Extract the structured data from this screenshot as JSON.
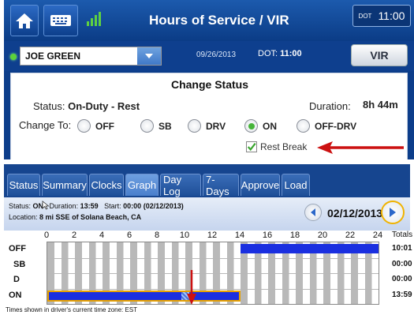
{
  "header": {
    "title": "Hours of Service / VIR",
    "dot_label": "DOT",
    "clock": "11:00",
    "driver_name": "JOE GREEN",
    "date": "09/26/2013",
    "dot_time_label": "DOT:",
    "dot_time": "11:00",
    "vir_label": "VIR"
  },
  "change_status": {
    "title": "Change Status",
    "status_label": "Status:",
    "status_value": "On-Duty - Rest",
    "duration_label": "Duration:",
    "duration_value": "8h 44m",
    "change_to_label": "Change To:",
    "options": [
      "OFF",
      "SB",
      "DRV",
      "ON",
      "OFF-DRV"
    ],
    "selected": "ON",
    "rest_break_label": "Rest Break",
    "rest_break_checked": true
  },
  "tabs": [
    {
      "label": "Status"
    },
    {
      "label": "Summary"
    },
    {
      "label": "Clocks"
    },
    {
      "label": "Graph",
      "active": true
    },
    {
      "label": "Day Log"
    },
    {
      "label": "7-Days"
    },
    {
      "label": "Approve"
    },
    {
      "label": "Load"
    }
  ],
  "graph_info": {
    "status_label": "Status:",
    "status_value": "ON",
    "duration_label": "Duration:",
    "duration_value": "13:59",
    "start_label": "Start:",
    "start_value": "00:00 (02/12/2013)",
    "location_label": "Location:",
    "location_value": "8 mi SSE of Solana Beach, CA",
    "nav_date": "02/12/2013"
  },
  "chart_data": {
    "type": "bar",
    "x_ticks": [
      "0",
      "2",
      "4",
      "6",
      "8",
      "10",
      "12",
      "14",
      "16",
      "18",
      "20",
      "22",
      "24"
    ],
    "rows": [
      "OFF",
      "SB",
      "D",
      "ON"
    ],
    "totals_label": "Totals",
    "totals": [
      "10:01",
      "00:00",
      "00:00",
      "13:59"
    ],
    "segments": [
      {
        "row": "ON",
        "start": 0,
        "end": 13.98
      },
      {
        "row": "OFF",
        "start": 13.98,
        "end": 24
      }
    ],
    "rest_break_at": 10,
    "footnote": "Times shown in driver's current time zone: EST"
  },
  "colors": {
    "duty_bar": "#1a2fe0",
    "highlight_border": "#e8a200",
    "arrow": "#cc1111"
  }
}
